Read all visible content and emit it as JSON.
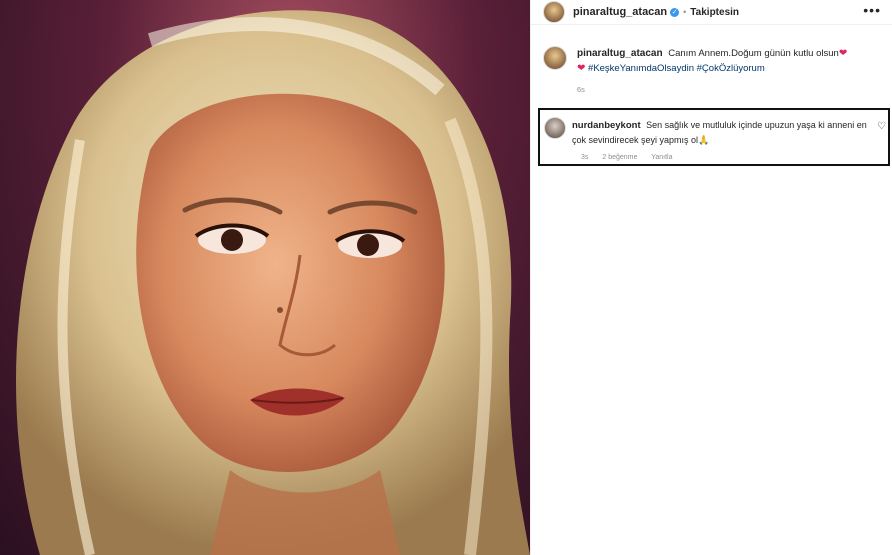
{
  "post": {
    "username": "pinaraltug_atacan",
    "verified_icon": "verified-badge-icon",
    "separator": "•",
    "follow_status": "Takiptesin",
    "more_icon": "•••"
  },
  "caption": {
    "username": "pinaraltug_atacan",
    "text_part1": "Canım Annem.Doğum günün kutlu olsun",
    "heart": "❤",
    "hashtag1": "#KeşkeYanımdaOlsaydin",
    "hashtag2": "#ÇokÖzlüyorum",
    "time": "6s"
  },
  "comment": {
    "username": "nurdanbeykont",
    "text": "Sen sağlık ve mutluluk içinde upuzun yaşa ki anneni en çok sevindirecek şeyi yapmış ol🙏",
    "time": "3s",
    "likes": "2 beğenme",
    "reply": "Yanıtla",
    "heart_icon": "♡"
  },
  "colors": {
    "link": "#00376b",
    "verified": "#3897f0",
    "heart": "#e0245e",
    "highlight_border": "#111111"
  }
}
